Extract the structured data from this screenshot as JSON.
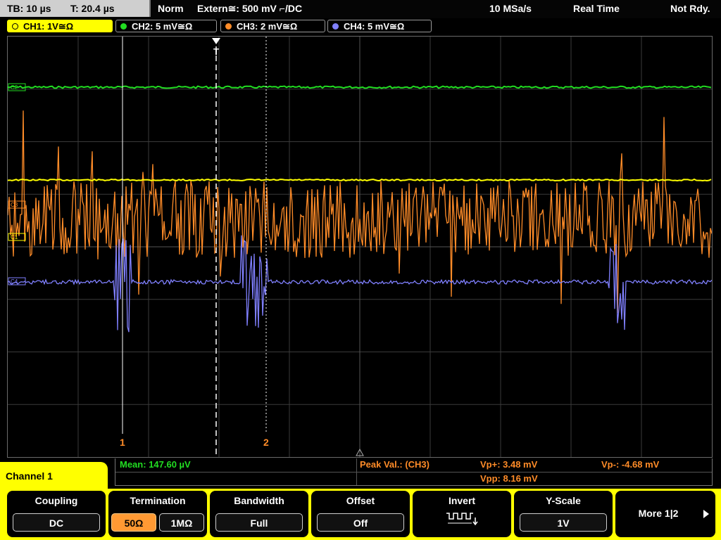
{
  "topbar": {
    "tb": "TB: 10 µs",
    "t": "T: 20.4 µs",
    "mode": "Norm",
    "trigger": "Extern≅: 500 mV ⌐/DC",
    "sample_rate": "10 MSa/s",
    "acq": "Real Time",
    "status": "Not Rdy."
  },
  "channels": [
    {
      "label": "CH1: 1V≅Ω",
      "color": "#ffff00"
    },
    {
      "label": "CH2: 5 mV≅Ω",
      "color": "#22dd22"
    },
    {
      "label": "CH3: 2 mV≅Ω",
      "color": "#ff8c28"
    },
    {
      "label": "CH4: 5 mV≅Ω",
      "color": "#8080ff"
    }
  ],
  "plot": {
    "trigger_marker": "T",
    "cursor1_label": "1",
    "cursor2_label": "2",
    "marker_c1": "C1",
    "marker_c2": "C2",
    "marker_c3": "C3",
    "marker_c4": "C4"
  },
  "measurements": {
    "mean": "Mean: 147.60 µV",
    "peak_label": "Peak Val.: (CH3)",
    "vp_plus": "Vp+: 3.48 mV",
    "vp_minus": "Vp-: -4.68 mV",
    "vpp": "Vpp: 8.16 mV"
  },
  "menu": {
    "title": "Channel 1",
    "coupling": {
      "label": "Coupling",
      "value": "DC"
    },
    "termination": {
      "label": "Termination",
      "opt1": "50Ω",
      "opt2": "1MΩ"
    },
    "bandwidth": {
      "label": "Bandwidth",
      "value": "Full"
    },
    "offset": {
      "label": "Offset",
      "value": "Off"
    },
    "invert": {
      "label": "Invert",
      "icon": "invert-pulse-icon"
    },
    "yscale": {
      "label": "Y-Scale",
      "value": "1V"
    },
    "more": {
      "label": "More 1|2"
    }
  }
}
